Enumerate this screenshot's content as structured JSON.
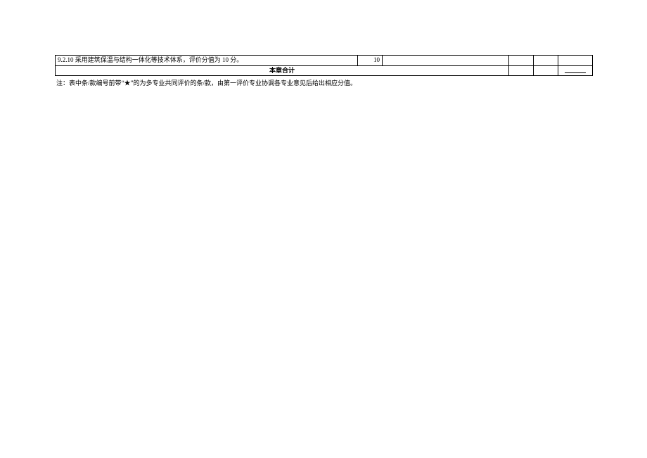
{
  "table": {
    "clipped_row": {
      "desc": "9.2.10 采用建筑保温与结构一体化等技术体系，评价分值为 10 分。",
      "num": "10"
    },
    "total_row": {
      "label": "本章合计"
    }
  },
  "footnote": "注：表中条/款编号前带“★”的为多专业共同评价的条/款，由第一评价专业协调各专业意见后给出相应分值。"
}
